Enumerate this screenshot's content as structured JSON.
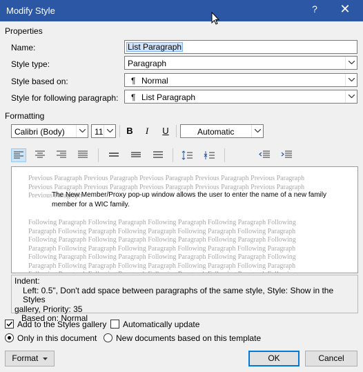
{
  "window": {
    "title": "Modify Style",
    "help_glyph": "?",
    "close_glyph": "✕"
  },
  "properties": {
    "heading": "Properties",
    "name_label": "Name:",
    "name_value": "List Paragraph",
    "style_type_label": "Style type:",
    "style_type_value": "Paragraph",
    "based_on_label": "Style based on:",
    "based_on_value": "Normal",
    "following_label": "Style for following paragraph:",
    "following_value": "List Paragraph",
    "para_mark": "¶"
  },
  "formatting": {
    "heading": "Formatting",
    "font": "Calibri (Body)",
    "size": "11",
    "bold": "B",
    "italic": "I",
    "underline": "U",
    "color": "Automatic"
  },
  "preview": {
    "previous": "Previous Paragraph Previous Paragraph Previous Paragraph Previous Paragraph Previous Paragraph Previous Paragraph Previous Paragraph Previous Paragraph Previous Paragraph Previous Paragraph Previous Paragraph",
    "current": "The New Member/Proxy pop-up window allows the user to enter the name of a new family member for a WIC family.",
    "following": "Following Paragraph Following Paragraph Following Paragraph Following Paragraph Following Paragraph Following Paragraph Following Paragraph Following Paragraph Following Paragraph Following Paragraph Following Paragraph Following Paragraph Following Paragraph Following Paragraph Following Paragraph Following Paragraph Following Paragraph Following Paragraph Following Paragraph Following Paragraph Following Paragraph Following Paragraph Following Paragraph Following Paragraph Following Paragraph Following Paragraph Following Paragraph Following Paragraph Following Paragraph Following Paragraph Following Paragraph Following Paragraph Following Paragraph Following Paragraph Following Paragraph Following Paragraph Following Paragraph Following Paragraph Following Paragraph Following Paragraph"
  },
  "description": {
    "line1": "Indent:",
    "line2": "Left:  0.5\", Don't add space between paragraphs of the same style, Style: Show in the Styles",
    "line3": "gallery, Priority: 35",
    "line4": "Based on: Normal"
  },
  "options": {
    "add_gallery": "Add to the Styles gallery",
    "auto_update": "Automatically update",
    "only_doc": "Only in this document",
    "new_docs": "New documents based on this template"
  },
  "buttons": {
    "format": "Format",
    "ok": "OK",
    "cancel": "Cancel"
  },
  "colors": {
    "titlebar": "#2b57a4",
    "accent": "#0078d7",
    "selection": "#cfe3fc"
  }
}
